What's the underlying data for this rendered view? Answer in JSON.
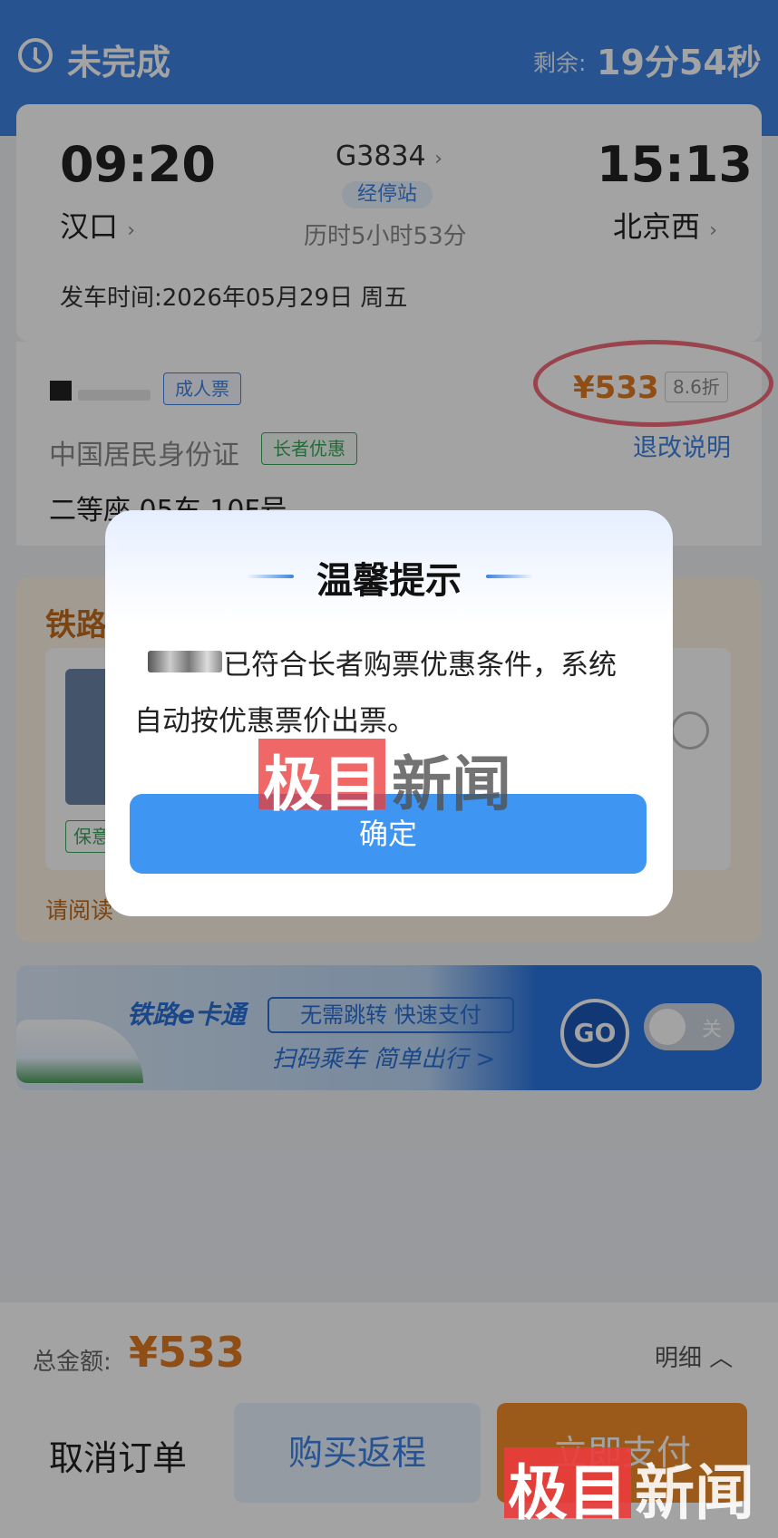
{
  "header": {
    "status_title": "未完成",
    "remaining_label": "剩余:",
    "remaining_time": "19分54秒"
  },
  "train": {
    "departure_time": "09:20",
    "arrival_time": "15:13",
    "train_number": "G3834",
    "stops_label": "经停站",
    "duration": "历时5小时53分",
    "departure_station": "汉口",
    "arrival_station": "北京西",
    "departure_date_label": "发车时间:",
    "departure_date": "2026年05月29日 周五"
  },
  "passenger": {
    "ticket_type": "成人票",
    "price": "¥533",
    "discount": "8.6折",
    "id_type": "中国居民身份证",
    "senior_tag": "长者优惠",
    "refund_link": "退改说明",
    "seat": "二等座 05车 10F号"
  },
  "insurance": {
    "title": "铁路",
    "tag": "保意",
    "read_text": "请阅读"
  },
  "banner": {
    "logo": "铁路e卡通",
    "box_text": "无需跳转 快速支付",
    "subtitle": "扫码乘车 简单出行 >",
    "go_label": "GO",
    "toggle_label": "关"
  },
  "footer": {
    "total_label": "总金额:",
    "total_amount": "¥533",
    "detail_link": "明细",
    "cancel_button": "取消订单",
    "return_button": "购买返程",
    "pay_button": "立即支付"
  },
  "modal": {
    "title": "温馨提示",
    "message_line1": "已符合长者购票优惠条件，系统",
    "message_line2": "自动按优惠票价出票。",
    "confirm_button": "确定"
  },
  "watermark": {
    "part1": "极目",
    "part2": "新闻"
  },
  "colors": {
    "header_blue": "#3e83e3",
    "price_orange": "#e07b22",
    "annotation_red": "#f06a7a"
  }
}
